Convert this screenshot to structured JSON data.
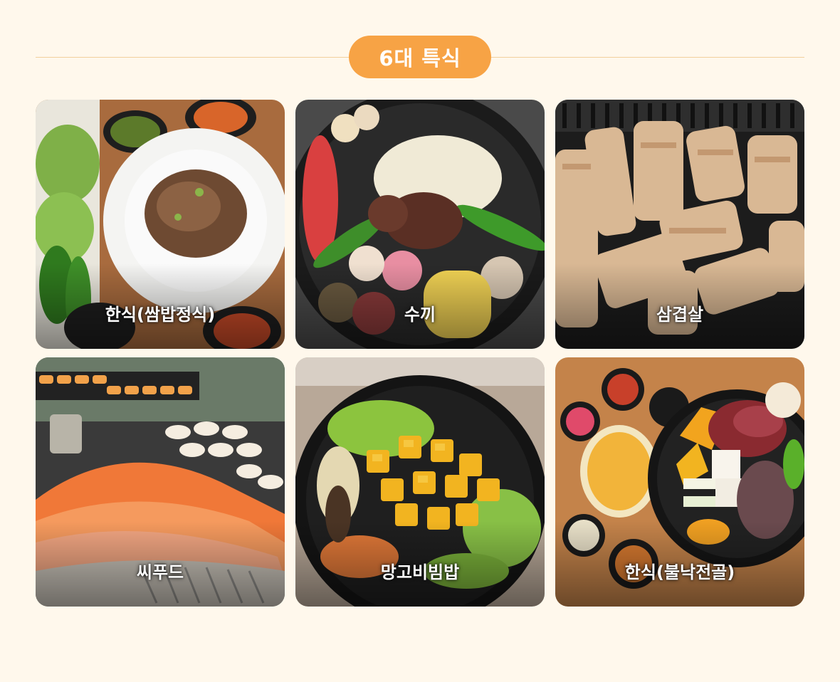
{
  "section": {
    "title": "6대 특식",
    "accent": "#f7a345",
    "background": "#fff8ec",
    "divider": "#f2cf9c"
  },
  "cards": [
    {
      "label": "한식(쌈밥정식)",
      "icon": "korean-ssambap-photo"
    },
    {
      "label": "수끼",
      "icon": "suki-hotpot-photo"
    },
    {
      "label": "삼겹살",
      "icon": "samgyeopsal-photo"
    },
    {
      "label": "씨푸드",
      "icon": "seafood-photo"
    },
    {
      "label": "망고비빔밥",
      "icon": "mango-bibimbap-photo"
    },
    {
      "label": "한식(불낙전골)",
      "icon": "bulnak-jeongol-photo"
    }
  ]
}
